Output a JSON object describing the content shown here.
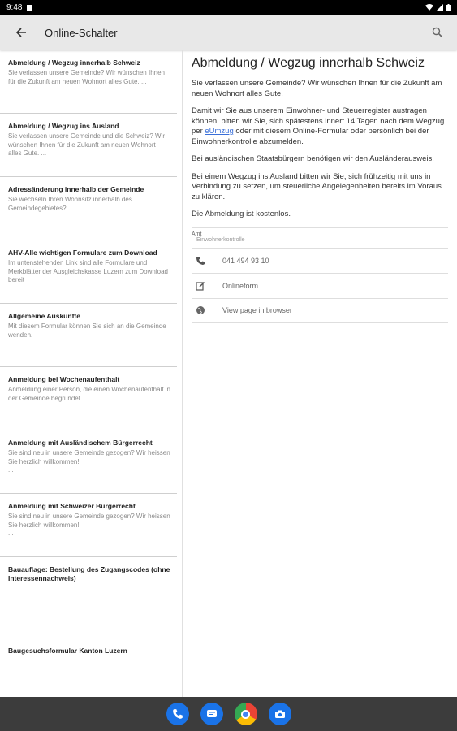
{
  "status_bar": {
    "time": "9:48"
  },
  "app_bar": {
    "title": "Online-Schalter",
    "back_icon": "arrow-back-icon",
    "search_icon": "search-icon"
  },
  "list": [
    {
      "title": "Abmeldung / Wegzug innerhalb Schweiz",
      "desc": "Sie verlassen unsere Gemeinde? Wir wünschen Ihnen für die Zukunft am neuen Wohnort alles Gute. ..."
    },
    {
      "title": "Abmeldung / Wegzug ins Ausland",
      "desc": "Sie verlassen unsere Gemeinde und die Schweiz? Wir wünschen Ihnen für die Zukunft am neuen Wohnort alles Gute. ..."
    },
    {
      "title": "Adressänderung innerhalb der Gemeinde",
      "desc": "Sie wechseln Ihren Wohnsitz innerhalb des Gemeindegebietes?\n..."
    },
    {
      "title": "AHV-Alle wichtigen Formulare zum Download",
      "desc": "Im untenstehenden Link sind alle Formulare und Merkblätter der Ausgleichskasse Luzern zum Download bereit"
    },
    {
      "title": "Allgemeine Auskünfte",
      "desc": "Mit diesem Formular können Sie sich an die Gemeinde wenden."
    },
    {
      "title": "Anmeldung bei Wochenaufenthalt",
      "desc": "Anmeldung einer Person, die einen Wochenaufenthalt in der Gemeinde begründet."
    },
    {
      "title": "Anmeldung mit Ausländischem Bürgerrecht",
      "desc": "Sie sind neu in unsere Gemeinde gezogen? Wir heissen Sie herzlich willkommen!\n..."
    },
    {
      "title": "Anmeldung mit Schweizer Bürgerrecht",
      "desc": "Sie sind neu in unsere Gemeinde gezogen? Wir heissen Sie herzlich willkommen!\n..."
    },
    {
      "title": "Bauauflage: Bestellung des Zugangscodes (ohne Interessennachweis)",
      "desc": ""
    },
    {
      "title": "Baugesuchsformular Kanton Luzern",
      "desc": ""
    }
  ],
  "detail": {
    "title": "Abmeldung / Wegzug innerhalb Schweiz",
    "p1": "Sie verlassen unsere Gemeinde? Wir wünschen Ihnen für die Zukunft am neuen Wohnort alles Gute.",
    "p2_before": "Damit wir Sie aus unserem Einwohner- und Steuerregister austragen können, bitten wir Sie, sich spätestens innert 14 Tagen nach dem Wegzug per ",
    "p2_link": "eUmzug",
    "p2_after": " oder mit diesem Online-Formular oder persönlich bei der Einwohnerkontrolle abzumelden.",
    "p3": "Bei ausländischen Staatsbürgern benötigen wir den Ausländerausweis.",
    "p4": "Bei einem Wegzug ins Ausland bitten wir Sie, sich frühzeitig mit uns in Verbindung zu setzen, um steuerliche Angelegenheiten bereits im Voraus zu klären.",
    "p5": "Die Abmeldung ist kostenlos.",
    "amt_label": "Amt",
    "amt_value": "Einwohnerkontrolle",
    "phone": "041 494 93 10",
    "onlineform": "Onlineform",
    "browser": "View page in browser"
  },
  "colors": {
    "link": "#3a6fd8",
    "app_bar": "#e8e8e8",
    "nav_bar": "#3c3c3c"
  }
}
